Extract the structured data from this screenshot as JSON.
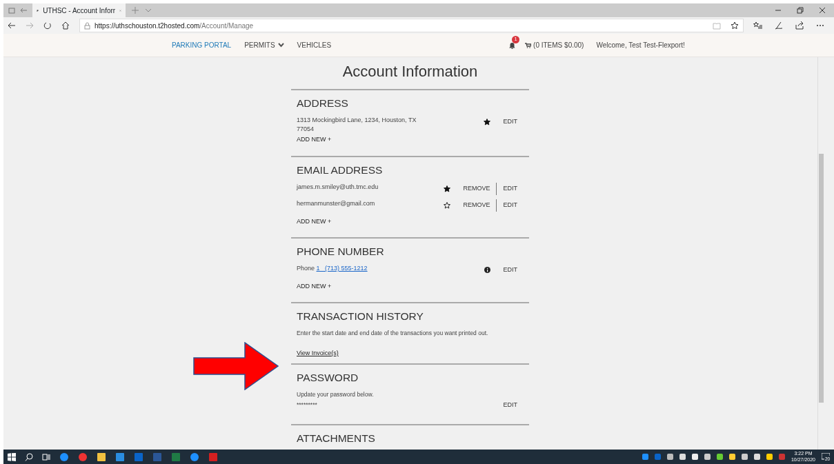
{
  "browser": {
    "tab_title": "UTHSC - Account Inforr",
    "url_host": "https://uthschouston.t2hosted.com",
    "url_path": "/Account/Manage"
  },
  "nav": {
    "items": [
      {
        "label": "PARKING PORTAL",
        "selected": true,
        "dropdown": false
      },
      {
        "label": "PERMITS",
        "selected": false,
        "dropdown": true
      },
      {
        "label": "VEHICLES",
        "selected": false,
        "dropdown": false
      }
    ],
    "notification_count": "1",
    "cart": "(0 ITEMS $0.00)",
    "welcome": "Welcome, Test Test-Flexport!"
  },
  "title": "Account Information",
  "sections": [
    {
      "kind": "list",
      "title": "ADDRESS",
      "entries": [
        {
          "kind": "star",
          "text": "1313 Mockingbird Lane, 1234, Houston, TX 77054",
          "primary": true,
          "actions": [
            "EDIT"
          ]
        }
      ],
      "add_new": "ADD NEW +"
    },
    {
      "kind": "list",
      "title": "EMAIL ADDRESS",
      "entries": [
        {
          "kind": "star",
          "text": "james.m.smiley@uth.tmc.edu",
          "primary": true,
          "actions": [
            "REMOVE",
            "EDIT"
          ]
        },
        {
          "kind": "star",
          "text": "hermanmunster@gmail.com",
          "primary": false,
          "actions": [
            "REMOVE",
            "EDIT"
          ]
        }
      ],
      "add_new": "ADD NEW +"
    },
    {
      "kind": "list",
      "title": "PHONE NUMBER",
      "entries": [
        {
          "kind": "info",
          "label": "Phone",
          "link": "1   (713) 555-1212",
          "actions": [
            "EDIT"
          ]
        }
      ],
      "add_new": "ADD NEW +"
    },
    {
      "kind": "transaction",
      "title": "TRANSACTION HISTORY",
      "text": "Enter the start date and end date of the transactions you want printed out.",
      "link": "View Invoice(s)"
    },
    {
      "kind": "password",
      "title": "PASSWORD",
      "text": "Update your password below.",
      "value": "*********",
      "action": "EDIT"
    },
    {
      "kind": "title_only",
      "title": "ATTACHMENTS"
    }
  ],
  "taskbar": {
    "time": "3:22 PM",
    "date": "10/27/2020",
    "notifications": "20"
  }
}
